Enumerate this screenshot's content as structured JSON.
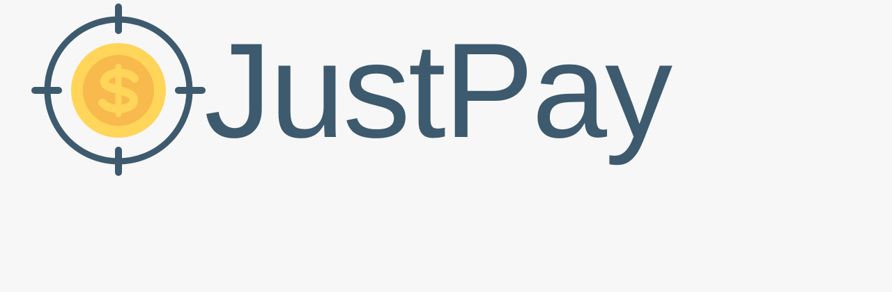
{
  "brand": {
    "name": "JustPay",
    "icon": "target-coin-icon"
  },
  "colors": {
    "background": "#f7f7f7",
    "primary": "#3d5a6e",
    "coin_outer": "#ffd55a",
    "coin_inner": "#f8b94d",
    "dollar": "#ffd55a"
  }
}
